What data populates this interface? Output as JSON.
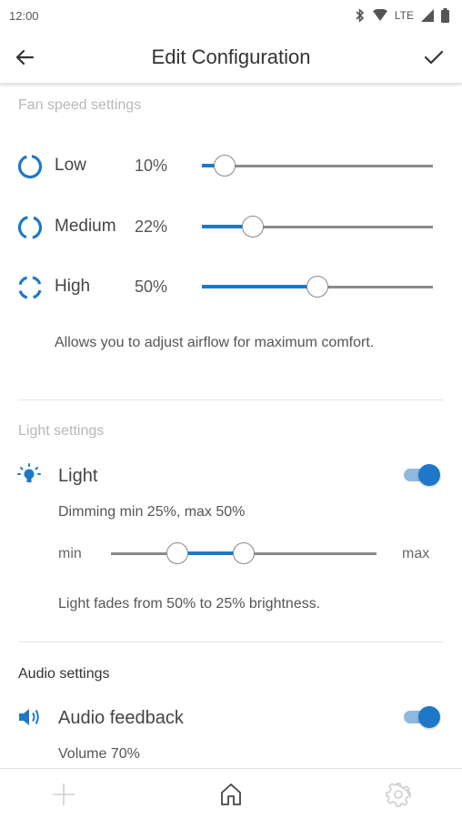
{
  "status_bar": {
    "time": "12:00",
    "network": "LTE",
    "icons": [
      "bluetooth-icon",
      "wifi-icon",
      "lte-signal-icon",
      "battery-icon"
    ]
  },
  "app_bar": {
    "title": "Edit Configuration",
    "back_icon": "arrow-left-icon",
    "confirm_icon": "check-icon"
  },
  "fan_section": {
    "header": "Fan speed settings",
    "speeds": [
      {
        "label": "Low",
        "value_text": "10%",
        "value": 10
      },
      {
        "label": "Medium",
        "value_text": "22%",
        "value": 22
      },
      {
        "label": "High",
        "value_text": "50%",
        "value": 50
      }
    ],
    "description": "Allows you to adjust airflow for maximum comfort."
  },
  "light_section": {
    "header": "Light settings",
    "label": "Light",
    "enabled": true,
    "dimming_text": "Dimming min 25%, max 50%",
    "range_min_label": "min",
    "range_max_label": "max",
    "range_low": 25,
    "range_high": 50,
    "fade_text": "Light fades from 50% to 25% brightness."
  },
  "audio_section": {
    "header": "Audio settings",
    "label": "Audio feedback",
    "enabled": true,
    "volume_text": "Volume 70%"
  },
  "bottom_nav": {
    "items": [
      "add-icon",
      "home-icon",
      "settings-icon"
    ]
  },
  "colors": {
    "accent": "#1f78c7",
    "toggle_track": "#8fb8e0",
    "muted_header": "#b8b8b8",
    "track": "#8a8a8a"
  }
}
